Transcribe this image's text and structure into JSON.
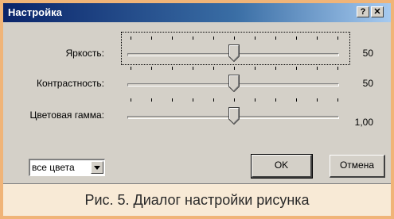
{
  "window": {
    "title": "Настройка",
    "help_glyph": "?",
    "close_glyph": "✕"
  },
  "sliders": [
    {
      "label": "Яркость:",
      "value_text": "50",
      "level_percent": 50
    },
    {
      "label": "Контрастность:",
      "value_text": "50",
      "level_percent": 50
    },
    {
      "label": "Цветовая гамма:",
      "value_text": "1,00",
      "level_percent": 50
    }
  ],
  "color_select": {
    "value": "все цвета"
  },
  "buttons": {
    "ok": "OK",
    "cancel": "Отмена"
  },
  "caption": "Рис. 5. Диалог настройки рисунка",
  "colors": {
    "dialog_face": "#d4d0c8",
    "titlebar_start": "#0a246a",
    "titlebar_end": "#a6caf0",
    "frame_border": "#f0b478",
    "caption_background": "#f8ead6"
  }
}
